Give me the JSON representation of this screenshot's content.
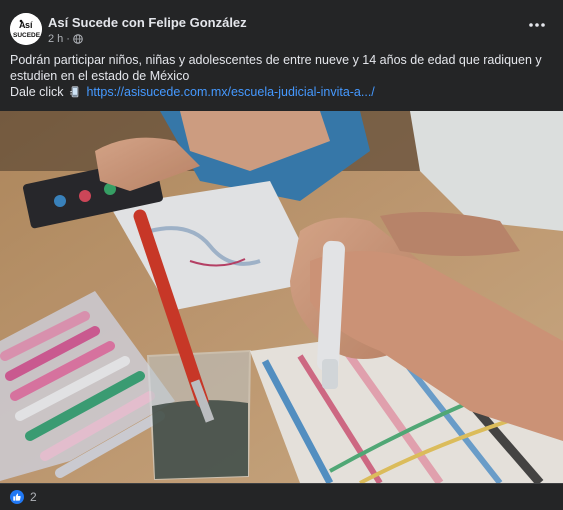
{
  "post": {
    "author": "Así Sucede con Felipe González",
    "time": "2 h",
    "separator": "·",
    "privacy_icon": "globe-icon",
    "avatar_logo_text": "ASÍ SUCEDE",
    "more_icon": "ellipsis-icon",
    "text_line1": "Podrán participar niños, niñas y adolescentes de entre nueve y 14 años de edad que radiquen y estudien en el estado de México",
    "cta_prefix": "Dale click",
    "cta_icon": "phone-tap-icon",
    "link_text": "https://asisucede.com.mx/escuela-judicial-invita-a.../",
    "image_description_icon": "photo"
  },
  "reactions": {
    "icon": "like-icon",
    "count": "2"
  },
  "colors": {
    "background": "#242526",
    "text": "#e4e6eb",
    "secondary_text": "#b0b3b8",
    "link": "#4599ff",
    "like_blue": "#2078f4"
  }
}
